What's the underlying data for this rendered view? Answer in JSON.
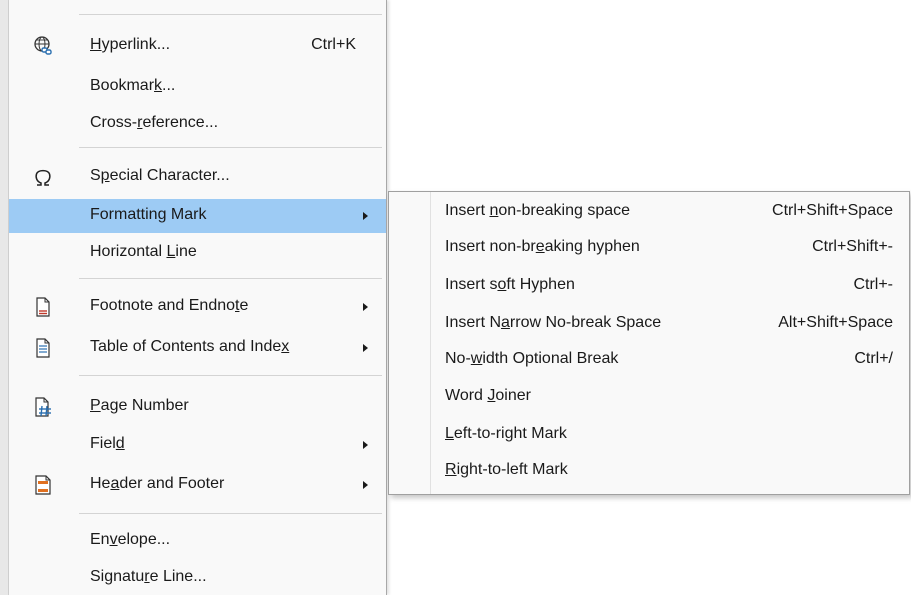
{
  "menu": {
    "items": [
      {
        "label_pre": "",
        "label_key": "H",
        "label_post": "yperlink...",
        "shortcut": "Ctrl+K",
        "icon": "globe-link-icon"
      },
      {
        "label_pre": "Bookmar",
        "label_key": "k",
        "label_post": "...",
        "shortcut": ""
      },
      {
        "label_pre": "Cross-",
        "label_key": "r",
        "label_post": "eference...",
        "shortcut": ""
      },
      {
        "label_pre": "S",
        "label_key": "p",
        "label_post": "ecial Character...",
        "shortcut": "",
        "icon": "omega-icon"
      },
      {
        "label_pre": "Formattin",
        "label_key": "g",
        "label_post": " Mark",
        "shortcut": "",
        "submenu": true,
        "highlighted": true
      },
      {
        "label_pre": "Horizontal ",
        "label_key": "L",
        "label_post": "ine",
        "shortcut": ""
      },
      {
        "label_pre": "Footnote and Endno",
        "label_key": "t",
        "label_post": "e",
        "shortcut": "",
        "submenu": true,
        "icon": "footnote-icon"
      },
      {
        "label_pre": "Table of Contents and Inde",
        "label_key": "x",
        "label_post": "",
        "shortcut": "",
        "submenu": true,
        "icon": "toc-icon"
      },
      {
        "label_pre": "",
        "label_key": "P",
        "label_post": "age Number",
        "shortcut": "",
        "icon": "page-number-icon"
      },
      {
        "label_pre": "Fiel",
        "label_key": "d",
        "label_post": "",
        "shortcut": "",
        "submenu": true
      },
      {
        "label_pre": "He",
        "label_key": "a",
        "label_post": "der and Footer",
        "shortcut": "",
        "submenu": true,
        "icon": "header-footer-icon"
      },
      {
        "label_pre": "En",
        "label_key": "v",
        "label_post": "elope...",
        "shortcut": ""
      },
      {
        "label_pre": "Signatu",
        "label_key": "r",
        "label_post": "e Line...",
        "shortcut": ""
      }
    ]
  },
  "submenu": {
    "items": [
      {
        "label_pre": "Insert ",
        "label_key": "n",
        "label_post": "on-breaking space",
        "shortcut": "Ctrl+Shift+Space"
      },
      {
        "label_pre": "Insert non-br",
        "label_key": "e",
        "label_post": "aking hyphen",
        "shortcut": "Ctrl+Shift+-"
      },
      {
        "label_pre": "Insert s",
        "label_key": "o",
        "label_post": "ft Hyphen",
        "shortcut": "Ctrl+-"
      },
      {
        "label_pre": "Insert N",
        "label_key": "a",
        "label_post": "rrow No-break Space",
        "shortcut": "Alt+Shift+Space"
      },
      {
        "label_pre": "No-",
        "label_key": "w",
        "label_post": "idth Optional Break",
        "shortcut": "Ctrl+/"
      },
      {
        "label_pre": "Word ",
        "label_key": "J",
        "label_post": "oiner",
        "shortcut": ""
      },
      {
        "label_pre": "",
        "label_key": "L",
        "label_post": "eft-to-right Mark",
        "shortcut": ""
      },
      {
        "label_pre": "",
        "label_key": "R",
        "label_post": "ight-to-left Mark",
        "shortcut": ""
      }
    ]
  },
  "colors": {
    "highlight": "#9dcbf4",
    "menu_bg": "#f9f9f9",
    "icon_red": "#c0392b",
    "icon_orange": "#e07020",
    "icon_blue": "#2a6fb0"
  }
}
